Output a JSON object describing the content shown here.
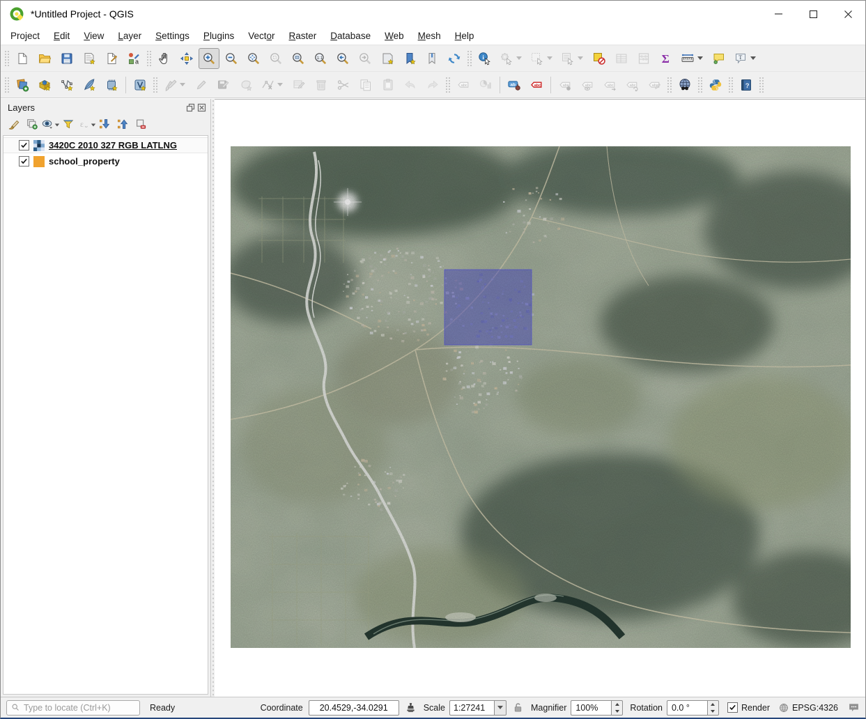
{
  "window": {
    "title": "*Untitled Project - QGIS",
    "controls": [
      {
        "name": "minimize-button",
        "icon": "winMin"
      },
      {
        "name": "maximize-button",
        "icon": "winMax"
      },
      {
        "name": "close-button",
        "icon": "winClose"
      }
    ]
  },
  "menubar": {
    "items": [
      {
        "pre": "Pro",
        "key": "j",
        "post": "ect",
        "name": "menu-project"
      },
      {
        "pre": "",
        "key": "E",
        "post": "dit",
        "name": "menu-edit"
      },
      {
        "pre": "",
        "key": "V",
        "post": "iew",
        "name": "menu-view"
      },
      {
        "pre": "",
        "key": "L",
        "post": "ayer",
        "name": "menu-layer"
      },
      {
        "pre": "",
        "key": "S",
        "post": "ettings",
        "name": "menu-settings"
      },
      {
        "pre": "",
        "key": "P",
        "post": "lugins",
        "name": "menu-plugins"
      },
      {
        "pre": "Vect",
        "key": "o",
        "post": "r",
        "name": "menu-vector"
      },
      {
        "pre": "",
        "key": "R",
        "post": "aster",
        "name": "menu-raster"
      },
      {
        "pre": "",
        "key": "D",
        "post": "atabase",
        "name": "menu-database"
      },
      {
        "pre": "",
        "key": "W",
        "post": "eb",
        "name": "menu-web"
      },
      {
        "pre": "",
        "key": "M",
        "post": "esh",
        "name": "menu-mesh"
      },
      {
        "pre": "",
        "key": "H",
        "post": "elp",
        "name": "menu-help"
      }
    ]
  },
  "toolbars": {
    "row1": [
      {
        "type": "grip"
      },
      {
        "name": "new-project",
        "icon": "page"
      },
      {
        "name": "open-project",
        "icon": "folderOpen"
      },
      {
        "name": "save-project",
        "icon": "floppy"
      },
      {
        "name": "new-print-layout",
        "icon": "newLayout"
      },
      {
        "name": "show-layout-manager",
        "icon": "layoutMgr"
      },
      {
        "name": "style-manager",
        "icon": "styleMgr"
      },
      {
        "type": "grip"
      },
      {
        "name": "pan-map",
        "icon": "hand"
      },
      {
        "name": "pan-to-selection",
        "icon": "panSel"
      },
      {
        "name": "zoom-in",
        "icon": "magPlus",
        "active": true
      },
      {
        "name": "zoom-out",
        "icon": "magMinus"
      },
      {
        "name": "zoom-full",
        "icon": "magFull"
      },
      {
        "name": "zoom-to-selection",
        "icon": "magSel",
        "disabled": true
      },
      {
        "name": "zoom-to-layer",
        "icon": "magLayer"
      },
      {
        "name": "zoom-native",
        "icon": "magNative"
      },
      {
        "name": "zoom-last",
        "icon": "magLast"
      },
      {
        "name": "zoom-next",
        "icon": "magNext",
        "disabled": true
      },
      {
        "name": "new-map-view",
        "icon": "newMapView"
      },
      {
        "name": "new-spatial-bookmark",
        "icon": "newBookmark"
      },
      {
        "name": "show-spatial-bookmarks",
        "icon": "showBookmarks"
      },
      {
        "name": "refresh-map",
        "icon": "refresh"
      },
      {
        "type": "grip"
      },
      {
        "name": "identify-features",
        "icon": "identify"
      },
      {
        "name": "run-feature-action",
        "icon": "runAction",
        "disabled": true,
        "dropdown": true
      },
      {
        "name": "select-features",
        "icon": "selectRect",
        "disabled": true,
        "dropdown": true
      },
      {
        "name": "select-features-by-value",
        "icon": "selectForm",
        "disabled": true,
        "dropdown": true
      },
      {
        "name": "deselect-all-features",
        "icon": "deselectAll"
      },
      {
        "name": "open-attribute-table",
        "icon": "attrTable",
        "disabled": true
      },
      {
        "name": "open-field-calculator",
        "icon": "fieldCalc",
        "disabled": true
      },
      {
        "name": "show-statistical-summary",
        "icon": "sigma"
      },
      {
        "name": "measure-line",
        "icon": "measure",
        "dropdown": true
      },
      {
        "name": "map-tips",
        "icon": "mapTips"
      },
      {
        "name": "text-annotation",
        "icon": "textAnnot",
        "dropdown": true
      }
    ],
    "row2": [
      {
        "type": "grip"
      },
      {
        "name": "data-source-manager",
        "icon": "dataSrcMgr"
      },
      {
        "name": "new-geopackage-layer",
        "icon": "geopackage"
      },
      {
        "name": "new-shapefile-layer",
        "icon": "newShapefile"
      },
      {
        "name": "new-spatialite-layer",
        "icon": "newSpatialite"
      },
      {
        "name": "new-temporary-scratch-layer",
        "icon": "memoryLayer"
      },
      {
        "type": "sep"
      },
      {
        "name": "new-virtual-layer",
        "icon": "virtualLayer"
      },
      {
        "type": "grip"
      },
      {
        "name": "current-edits",
        "icon": "pencils",
        "disabled": true,
        "dropdown": true
      },
      {
        "name": "toggle-editing",
        "icon": "pencil",
        "disabled": true
      },
      {
        "name": "save-layer-edits",
        "icon": "saveEdits",
        "disabled": true
      },
      {
        "name": "add-feature",
        "icon": "blobStar",
        "disabled": true
      },
      {
        "name": "vertex-tool",
        "icon": "vertexTool",
        "disabled": true,
        "dropdown": true
      },
      {
        "name": "modify-attributes",
        "icon": "multiedit",
        "disabled": true
      },
      {
        "name": "delete-selected",
        "icon": "trash",
        "disabled": true
      },
      {
        "name": "cut-features",
        "icon": "scissors",
        "disabled": true
      },
      {
        "name": "copy-features",
        "icon": "copyF",
        "disabled": true
      },
      {
        "name": "paste-features",
        "icon": "pasteF",
        "disabled": true
      },
      {
        "name": "undo",
        "icon": "undoArr",
        "disabled": true
      },
      {
        "name": "redo",
        "icon": "redoArr",
        "disabled": true
      },
      {
        "type": "grip"
      },
      {
        "name": "highlight-pinned-labels",
        "icon": "abcTag",
        "disabled": true
      },
      {
        "name": "diagram-options-toolbar",
        "icon": "diagram",
        "disabled": true
      },
      {
        "type": "sep"
      },
      {
        "name": "layer-labeling-options",
        "icon": "labelBlue"
      },
      {
        "name": "layer-diagram-options",
        "icon": "labelRed"
      },
      {
        "type": "sep"
      },
      {
        "name": "pin-unpin-labels",
        "icon": "abcPin",
        "disabled": true
      },
      {
        "name": "show-hide-labels",
        "icon": "abcEye",
        "disabled": true
      },
      {
        "name": "move-label",
        "icon": "abcMove",
        "disabled": true
      },
      {
        "name": "rotate-label",
        "icon": "abcRotate",
        "disabled": true
      },
      {
        "name": "change-label",
        "icon": "abcEdit",
        "disabled": true
      },
      {
        "type": "grip"
      },
      {
        "name": "metasearch",
        "icon": "metasearch"
      },
      {
        "type": "grip"
      },
      {
        "name": "python-console",
        "icon": "python"
      },
      {
        "type": "grip"
      },
      {
        "name": "help-contents",
        "icon": "helpBook"
      },
      {
        "type": "grip"
      }
    ]
  },
  "layers_panel": {
    "title": "Layers",
    "header_buttons": [
      {
        "name": "float-panel",
        "icon": "floatPanel"
      },
      {
        "name": "close-panel",
        "icon": "closePanel"
      }
    ],
    "toolbar": [
      {
        "name": "open-layer-styling",
        "icon": "brush"
      },
      {
        "name": "add-group",
        "icon": "addGroup"
      },
      {
        "name": "manage-map-themes",
        "icon": "eyeTheme",
        "dropdown": true
      },
      {
        "name": "filter-legend",
        "icon": "funnel"
      },
      {
        "name": "filter-legend-by-expression",
        "icon": "epsilon",
        "disabled": true,
        "dropdown": true
      },
      {
        "name": "expand-all",
        "icon": "expandAll"
      },
      {
        "name": "collapse-all",
        "icon": "collapseAll"
      },
      {
        "name": "remove-layer",
        "icon": "removeLayer"
      }
    ],
    "layers": [
      {
        "label": "3420C 2010 327 RGB LATLNG",
        "checked": true,
        "type": "raster",
        "selected": true
      },
      {
        "label": "school_property",
        "checked": true,
        "type": "polygon",
        "swatch": "#f0a22e",
        "selected": false
      }
    ]
  },
  "map": {
    "overlay_fill": "#4343cf",
    "overlay_stroke": "#5a5ae0"
  },
  "statusbar": {
    "locate_placeholder": "Type to locate (Ctrl+K)",
    "status": "Ready",
    "coordinate_label": "Coordinate",
    "coordinate_value": "20.4529,-34.0291",
    "scale_label": "Scale",
    "scale_value": "1:27241",
    "magnifier_label": "Magnifier",
    "magnifier_value": "100%",
    "rotation_label": "Rotation",
    "rotation_value": "0.0 °",
    "render_label": "Render",
    "render_checked": true,
    "crs": "EPSG:4326"
  }
}
